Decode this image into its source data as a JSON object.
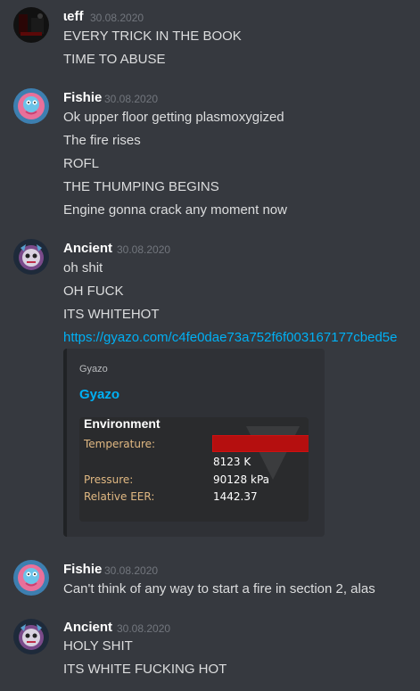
{
  "messages": [
    {
      "username": "ɩeff",
      "timestamp": "30.08.2020",
      "avatar_icon": "dark-room-avatar-icon",
      "lines": [
        "EVERY TRICK IN THE BOOK",
        "TIME TO ABUSE"
      ]
    },
    {
      "username": "Fishie",
      "timestamp": "30.08.2020",
      "avatar_icon": "fishie-avatar-icon",
      "lines": [
        "Ok upper floor getting plasmoxygized",
        "The fire rises",
        "ROFL",
        "THE THUMPING BEGINS",
        "Engine gonna crack any moment now"
      ]
    },
    {
      "username": "Ancient",
      "timestamp": "30.08.2020",
      "avatar_icon": "ancient-avatar-icon",
      "lines": [
        "oh shit",
        "OH FUCK",
        "ITS WHITEHOT"
      ],
      "link": "https://gyazo.com/c4fe0dae73a752f6f003167177cbed5e",
      "embed": {
        "provider": "Gyazo",
        "title": "Gyazo",
        "image": {
          "heading": "Environment",
          "temperature_label": "Temperature:",
          "temperature_value": "8123 K",
          "pressure_label": "Pressure:",
          "pressure_value": "90128 kPa",
          "eer_label": "Relative EER:",
          "eer_value": "1442.37",
          "temperature_bar_color": "#b50f0f"
        }
      }
    },
    {
      "username": "Fishie",
      "timestamp": "30.08.2020",
      "avatar_icon": "fishie-avatar-icon",
      "lines": [
        "Can't think of any way to start a fire in section 2, alas"
      ]
    },
    {
      "username": "Ancient",
      "timestamp": "30.08.2020",
      "avatar_icon": "ancient-avatar-icon",
      "lines": [
        "HOLY SHIT",
        "ITS WHITE FUCKING HOT"
      ]
    }
  ],
  "colors": {
    "background": "#36393f",
    "text": "#dcddde",
    "username": "#ffffff",
    "timestamp": "#72767d",
    "link": "#00b0f4"
  }
}
